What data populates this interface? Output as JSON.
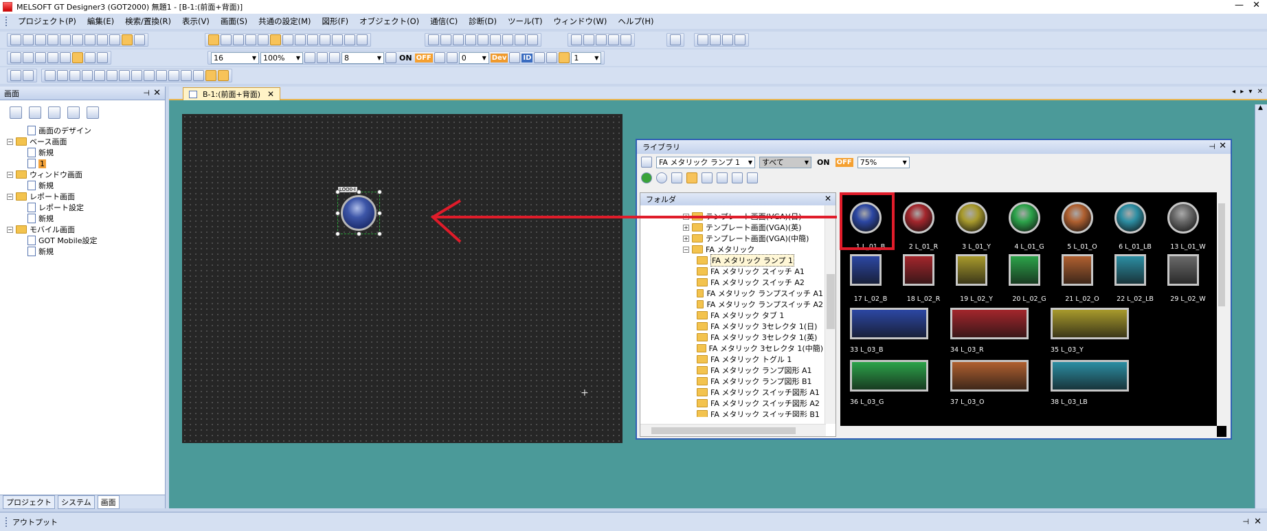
{
  "window": {
    "title": "MELSOFT GT Designer3 (GOT2000) 無題1 - [B-1:(前面+背面)]",
    "min_glyph": "—",
    "close_glyph": "✕"
  },
  "menu": [
    "プロジェクト(P)",
    "編集(E)",
    "検索/置換(R)",
    "表示(V)",
    "画面(S)",
    "共通の設定(M)",
    "図形(F)",
    "オブジェクト(O)",
    "通信(C)",
    "診断(D)",
    "ツール(T)",
    "ウィンドウ(W)",
    "ヘルプ(H)"
  ],
  "toolbar": {
    "font_size": "16",
    "zoom": "100%",
    "grid": "8",
    "on_label": "ON",
    "off_label": "OFF",
    "state_value": "0",
    "layer_value": "1",
    "dev_label": "Dev",
    "id_label": "ID"
  },
  "left_panel": {
    "title": "画面",
    "tree": [
      {
        "label": "画面のデザイン",
        "level": 1,
        "kind": "doc"
      },
      {
        "label": "ベース画面",
        "level": 0,
        "kind": "folder",
        "expanded": true
      },
      {
        "label": "新規",
        "level": 1,
        "kind": "doc"
      },
      {
        "label": "1",
        "level": 1,
        "kind": "doc",
        "selected": true
      },
      {
        "label": "ウィンドウ画面",
        "level": 0,
        "kind": "folder",
        "expanded": true
      },
      {
        "label": "新規",
        "level": 1,
        "kind": "doc"
      },
      {
        "label": "レポート画面",
        "level": 0,
        "kind": "folder",
        "expanded": true
      },
      {
        "label": "レポート設定",
        "level": 1,
        "kind": "doc"
      },
      {
        "label": "新規",
        "level": 1,
        "kind": "doc"
      },
      {
        "label": "モバイル画面",
        "level": 0,
        "kind": "folder",
        "expanded": true
      },
      {
        "label": "GOT Mobile設定",
        "level": 1,
        "kind": "doc"
      },
      {
        "label": "新規",
        "level": 1,
        "kind": "doc"
      }
    ],
    "tabs": [
      "プロジェクト",
      "システム",
      "画面"
    ]
  },
  "document": {
    "tab_label": "B-1:(前面+背面)",
    "lamp_tag": "LOO0-I",
    "nav": "◂ ▸ ▾ ✕"
  },
  "library": {
    "title": "ライブラリ",
    "selected_library": "FA メタリック ランプ 1",
    "filter": "すべて",
    "on_label": "ON",
    "off_label": "OFF",
    "zoom": "75%",
    "folder_title": "フォルダ",
    "folders": [
      {
        "label": "テンプレート画面(VGA)(日)",
        "sub": false
      },
      {
        "label": "テンプレート画面(VGA)(英)",
        "sub": false
      },
      {
        "label": "テンプレート画面(VGA)(中簡)",
        "sub": false
      },
      {
        "label": "FA メタリック",
        "sub": false
      },
      {
        "label": "FA メタリック ランプ 1",
        "sub": true,
        "selected": true
      },
      {
        "label": "FA メタリック スイッチ A1",
        "sub": true
      },
      {
        "label": "FA メタリック スイッチ A2",
        "sub": true
      },
      {
        "label": "FA メタリック ランプスイッチ A1",
        "sub": true
      },
      {
        "label": "FA メタリック ランプスイッチ A2",
        "sub": true
      },
      {
        "label": "FA メタリック タブ 1",
        "sub": true
      },
      {
        "label": "FA メタリック 3セレクタ 1(日)",
        "sub": true
      },
      {
        "label": "FA メタリック 3セレクタ 1(英)",
        "sub": true
      },
      {
        "label": "FA メタリック 3セレクタ 1(中簡)",
        "sub": true
      },
      {
        "label": "FA メタリック トグル 1",
        "sub": true
      },
      {
        "label": "FA メタリック ランプ図形 A1",
        "sub": true
      },
      {
        "label": "FA メタリック ランプ図形 B1",
        "sub": true
      },
      {
        "label": "FA メタリック スイッチ図形 A1",
        "sub": true
      },
      {
        "label": "FA メタリック スイッチ図形 A2",
        "sub": true
      },
      {
        "label": "FA メタリック スイッチ図形 B1",
        "sub": true
      }
    ],
    "parts_row1": [
      {
        "label": "1 L_01_B",
        "color": "#2c47a3"
      },
      {
        "label": "2 L_01_R",
        "color": "#a3262c"
      },
      {
        "label": "3 L_01_Y",
        "color": "#a89a2c"
      },
      {
        "label": "4 L_01_G",
        "color": "#2ca34a"
      },
      {
        "label": "5 L_01_O",
        "color": "#b06030"
      },
      {
        "label": "6 L_01_LB",
        "color": "#2c8ea3"
      },
      {
        "label": "13 L_01_W",
        "color": "#6a6a6a"
      }
    ],
    "parts_row2": [
      {
        "label": "17 L_02_B",
        "color": "#2c47a3"
      },
      {
        "label": "18 L_02_R",
        "color": "#a3262c"
      },
      {
        "label": "19 L_02_Y",
        "color": "#a89a2c"
      },
      {
        "label": "20 L_02_G",
        "color": "#2ca34a"
      },
      {
        "label": "21 L_02_O",
        "color": "#b06030"
      },
      {
        "label": "22 L_02_LB",
        "color": "#2c8ea3"
      },
      {
        "label": "29 L_02_W",
        "color": "#6a6a6a"
      }
    ],
    "parts_row3": [
      {
        "label": "33 L_03_B",
        "color": "#2c47a3"
      },
      {
        "label": "34 L_03_R",
        "color": "#a3262c"
      },
      {
        "label": "35 L_03_Y",
        "color": "#a89a2c"
      }
    ],
    "parts_row4": [
      {
        "label": "36 L_03_G",
        "color": "#2ca34a"
      },
      {
        "label": "37 L_03_O",
        "color": "#b06030"
      },
      {
        "label": "38 L_03_LB",
        "color": "#2c8ea3"
      }
    ]
  },
  "output": {
    "title": "アウトプット"
  },
  "colors": {
    "highlight": "#e01c2a",
    "accent": "#f3a23a"
  }
}
